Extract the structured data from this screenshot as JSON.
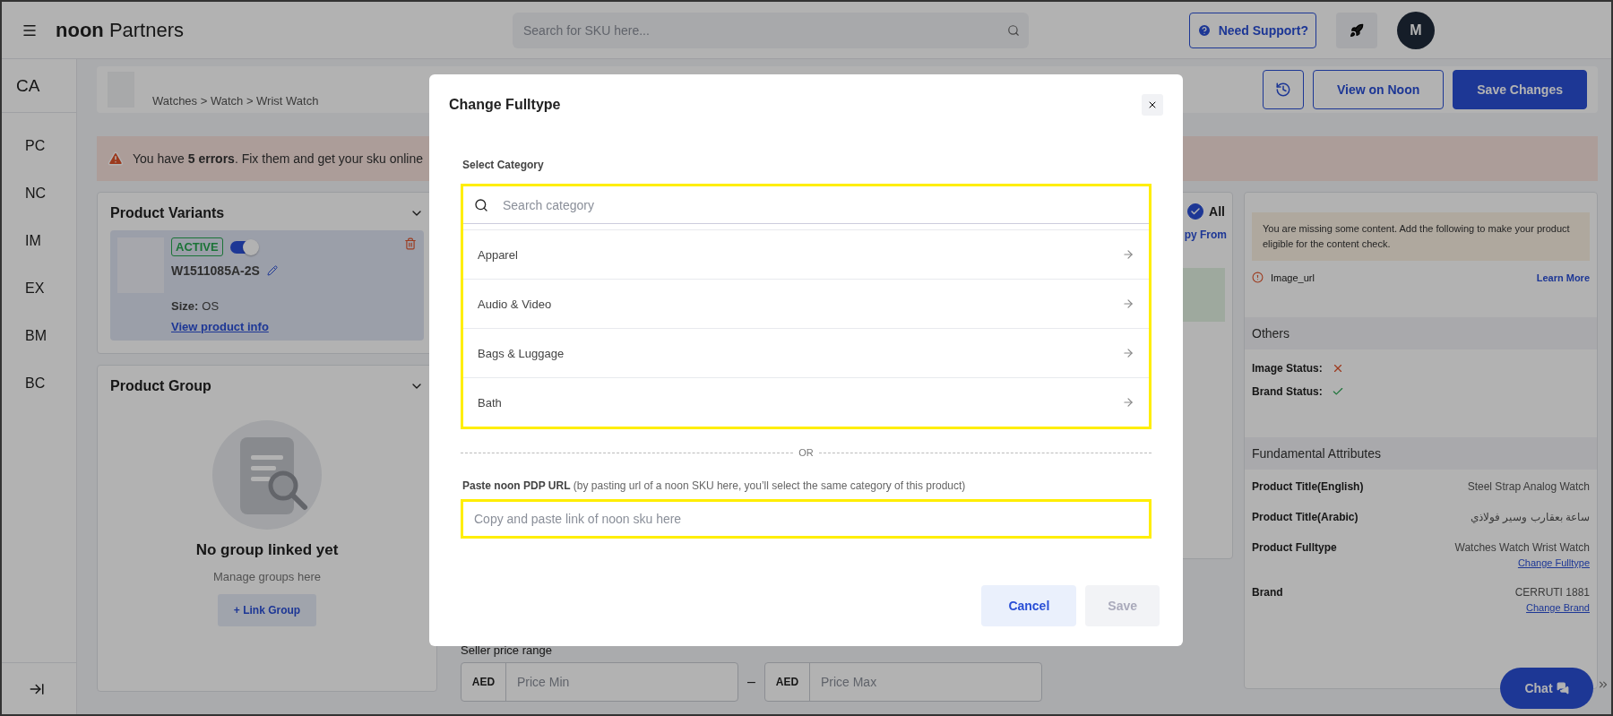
{
  "top_bar": {
    "logo": "**noon** Partners",
    "search": {
      "placeholder": "Search for SKU here..."
    },
    "support_button": "Need Support?",
    "avatar": "M"
  },
  "sidebar": {
    "items": [
      {
        "label": "CA",
        "selected": true
      },
      {
        "label": "PC",
        "selected": false
      },
      {
        "label": "NC",
        "selected": false
      },
      {
        "label": "IM",
        "selected": false
      },
      {
        "label": "EX",
        "selected": false
      },
      {
        "label": "BM",
        "selected": false
      },
      {
        "label": "BC",
        "selected": false
      }
    ]
  },
  "header": {
    "breadcrumb": "Watches > Watch > Wrist Watch",
    "buttons": [
      {
        "label": "View on Noon",
        "kind": "outline"
      },
      {
        "label": "Save Changes",
        "kind": "primary"
      }
    ]
  },
  "error_banner": "You have **5 errors**. Fix them and get your sku online",
  "variants": {
    "title": "Product Variants",
    "status": "ACTIVE",
    "on": true,
    "sku": "W1511085A-2S",
    "size_label": "Size:",
    "size": "OS",
    "link": "View product info"
  },
  "group": {
    "title": "Product Group",
    "empty_title": "No group linked yet",
    "empty_text": "Manage groups here",
    "button": "+ Link Group"
  },
  "middle": {
    "select_all": {
      "label": "All",
      "checked": true
    },
    "copy_link": "py From",
    "price": {
      "label": "Seller price range",
      "separator": "–",
      "fields": [
        {
          "currency": "AED",
          "placeholder": "Price Min"
        },
        {
          "currency": "AED",
          "placeholder": "Price Max"
        }
      ]
    }
  },
  "right_panel": {
    "notice": "You are missing some content. Add the following to make your product eligible for the content check.",
    "missing": [
      {
        "field": "Image_url",
        "link": "Learn More"
      }
    ],
    "others": {
      "title": "Others",
      "items": [
        {
          "label": "Image Status:",
          "ok": false
        },
        {
          "label": "Brand Status:",
          "ok": true
        }
      ]
    },
    "attributes": {
      "title": "Fundamental Attributes",
      "rows": [
        {
          "label": "Product Title(English)",
          "value": "Steel Strap Analog Watch"
        },
        {
          "label": "Product Title(Arabic)",
          "value": "ساعة بعقارب وسير فولاذي"
        },
        {
          "label": "Product Fulltype",
          "value": "Watches Watch Wrist Watch",
          "link": "Change Fulltype"
        },
        {
          "label": "Brand",
          "value": "CERRUTI 1881",
          "link": "Change Brand"
        }
      ]
    }
  },
  "chat_button": "Chat",
  "modal": {
    "title": "Change Fulltype",
    "category_label": "Select Category",
    "search": {
      "placeholder": "Search category"
    },
    "categories": [
      "Apparel",
      "Audio & Video",
      "Bags & Luggage",
      "Bath"
    ],
    "divider": "OR",
    "url_label": "**Paste noon PDP URL** (by pasting url of a noon SKU here, you’ll select the same category of this product)",
    "url_field": {
      "placeholder": "Copy and paste link of noon sku here"
    },
    "buttons": [
      {
        "label": "Cancel",
        "disabled": false
      },
      {
        "label": "Save",
        "disabled": true
      }
    ]
  }
}
